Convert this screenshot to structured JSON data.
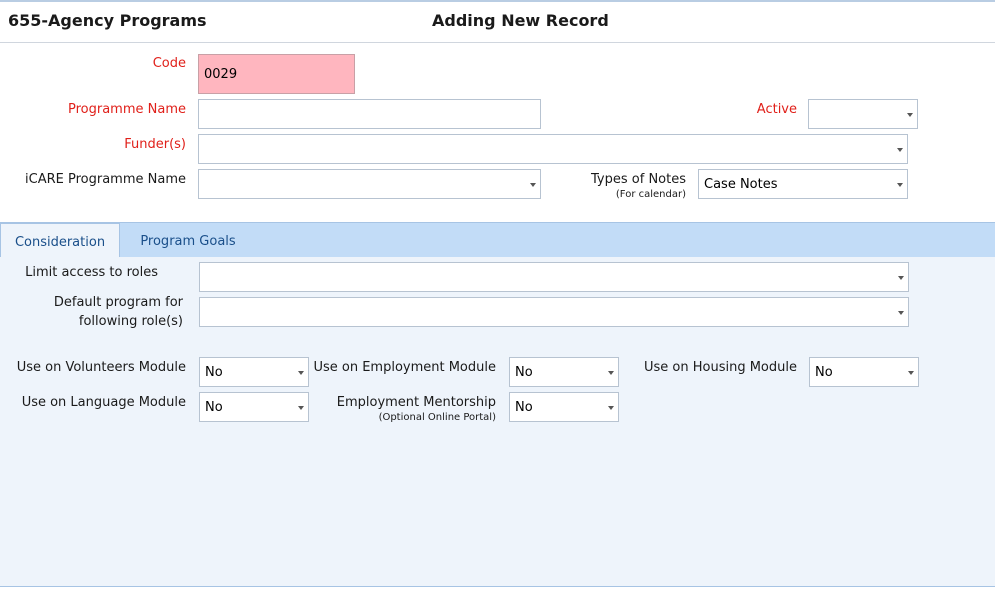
{
  "header": {
    "app_title": "655-Agency Programs",
    "page_title": "Adding New Record"
  },
  "form": {
    "code": {
      "label": "Code",
      "value": "0029"
    },
    "programme_name": {
      "label": "Programme Name",
      "value": ""
    },
    "active": {
      "label": "Active",
      "value": ""
    },
    "funders": {
      "label": "Funder(s)",
      "value": ""
    },
    "icare_programme_name": {
      "label": "iCARE Programme Name",
      "value": ""
    },
    "types_of_notes": {
      "label": "Types of Notes",
      "sublabel": "(For calendar)",
      "value": "Case Notes"
    }
  },
  "tabs": [
    {
      "label": "Consideration",
      "active": true
    },
    {
      "label": "Program Goals",
      "active": false
    }
  ],
  "consideration": {
    "limit_access": {
      "label": "Limit access to roles",
      "value": ""
    },
    "default_program": {
      "label_line1": "Default program for",
      "label_line2": "following role(s)",
      "value": ""
    },
    "volunteers": {
      "label": "Use on Volunteers Module",
      "value": "No"
    },
    "employment": {
      "label": "Use on Employment Module",
      "value": "No"
    },
    "housing": {
      "label": "Use on Housing Module",
      "value": "No"
    },
    "language": {
      "label": "Use on Language Module",
      "value": "No"
    },
    "mentorship": {
      "label": "Employment Mentorship",
      "sublabel": "(Optional Online Portal)",
      "value": "No"
    }
  },
  "colors": {
    "required_label": "#e0201a",
    "code_field_bg": "#ffb6bf",
    "tab_bar": "#c2dcf7",
    "panel_bg": "#eef4fb",
    "tab_text": "#1a4f8a"
  }
}
